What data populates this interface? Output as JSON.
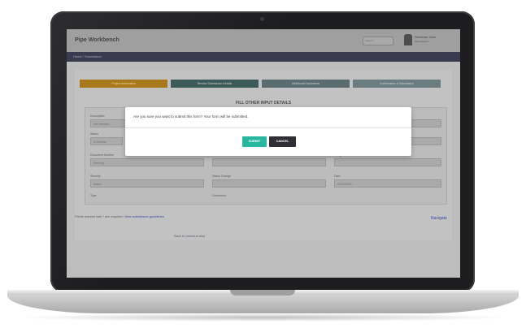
{
  "app": {
    "title": "Pipe Workbench",
    "search_placeholder": "Search...",
    "user_name": "Reviewer User",
    "user_role": "Administrator"
  },
  "breadcrumb": "Home / Submission",
  "steps": [
    {
      "label": "Project Information"
    },
    {
      "label": "Review Submission Details"
    },
    {
      "label": "Additional Documents"
    },
    {
      "label": "Confirmation & Submission"
    }
  ],
  "section_heading": "FILL OTHER INPUT DETAILS",
  "form": {
    "labels": [
      "Description",
      "Status",
      "Resolution Note",
      "Document Number",
      "Revision Number",
      "Assigned To",
      "Severity",
      "Status Change",
      "Date",
      "Type",
      "Comments"
    ],
    "values": [
      "Not selected",
      "In Review",
      "Pending",
      "Active",
      "12/02/2020"
    ]
  },
  "footer": {
    "note_prefix": "Fields marked with * are required. ",
    "note_link": "View submission guidelines",
    "link2": "Back to previous step",
    "nav_right": "Navigate"
  },
  "modal": {
    "message": "Are you sure you want to submit this form? Your form will be submitted.",
    "submit_label": "SUBMIT",
    "cancel_label": "CANCEL"
  },
  "colors": {
    "submit": "#28b7a0",
    "cancel": "#2f2f35",
    "active_step": "#a8781c",
    "nav": "#3a3a4e"
  }
}
